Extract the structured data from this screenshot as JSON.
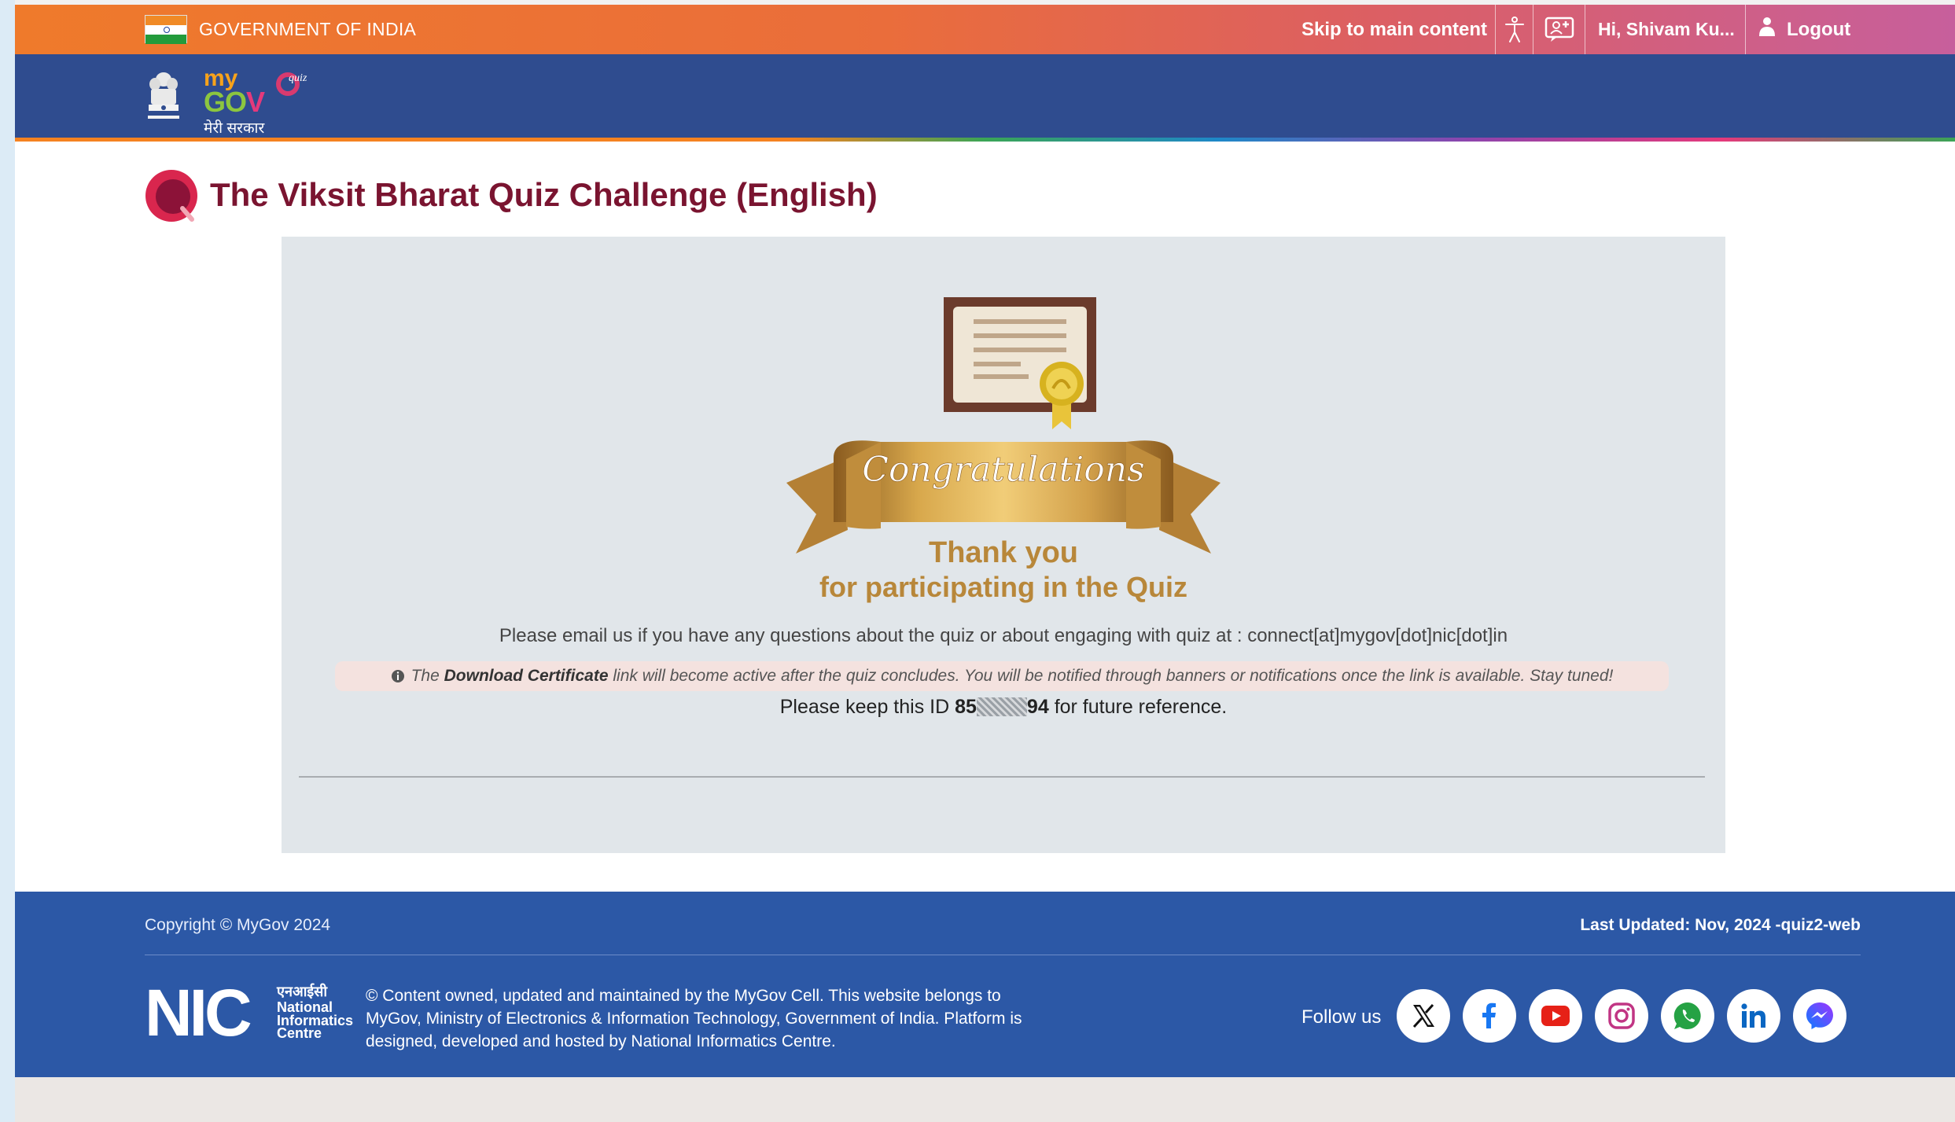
{
  "topbar": {
    "gov_title": "GOVERNMENT OF INDIA",
    "skip_link": "Skip to main content",
    "user_greeting": "Hi, Shivam Ku...",
    "logout_label": "Logout"
  },
  "header": {
    "logo_my": "my",
    "logo_gov_g": "G",
    "logo_gov_o": "O",
    "logo_gov_v": "V",
    "logo_hindi": "मेरी सरकार",
    "quiz_badge": "quiz"
  },
  "page": {
    "title": "The Viksit Bharat Quiz Challenge (English)"
  },
  "result": {
    "banner_text": "Congratulations",
    "thank_you": "Thank you",
    "participating": "for participating in the Quiz",
    "email_line": "Please email us if you have any questions about the quiz or about engaging with quiz at : connect[at]mygov[dot]nic[dot]in",
    "notice_prefix": "The",
    "notice_bold": "Download Certificate",
    "notice_suffix": "link will become active after the quiz concludes. You will be notified through banners or notifications once the link is available. Stay tuned!",
    "id_prefix": "Please keep this ID",
    "id_start": "85",
    "id_end": "94",
    "id_suffix": "for future reference."
  },
  "footer": {
    "copyright": "Copyright © MyGov 2024",
    "last_updated": "Last Updated: Nov, 2024 -quiz2-web",
    "content_owned": "© Content owned, updated and maintained by the MyGov Cell. This website belongs to MyGov, Ministry of Electronics & Information Technology, Government of India. Platform is designed, developed and hosted by National Informatics Centre.",
    "nic_hindi": "एनआईसी",
    "nic_line1": "National",
    "nic_line2": "Informatics",
    "nic_line3": "Centre",
    "follow_us": "Follow us",
    "socials": [
      "x-icon",
      "facebook-icon",
      "youtube-icon",
      "instagram-icon",
      "whatsapp-icon",
      "linkedin-icon",
      "messenger-icon"
    ]
  },
  "colors": {
    "title": "#7a1430",
    "header_blue": "#2f4c8f",
    "footer_blue": "#2c58a6",
    "gold": "#b8873a"
  }
}
